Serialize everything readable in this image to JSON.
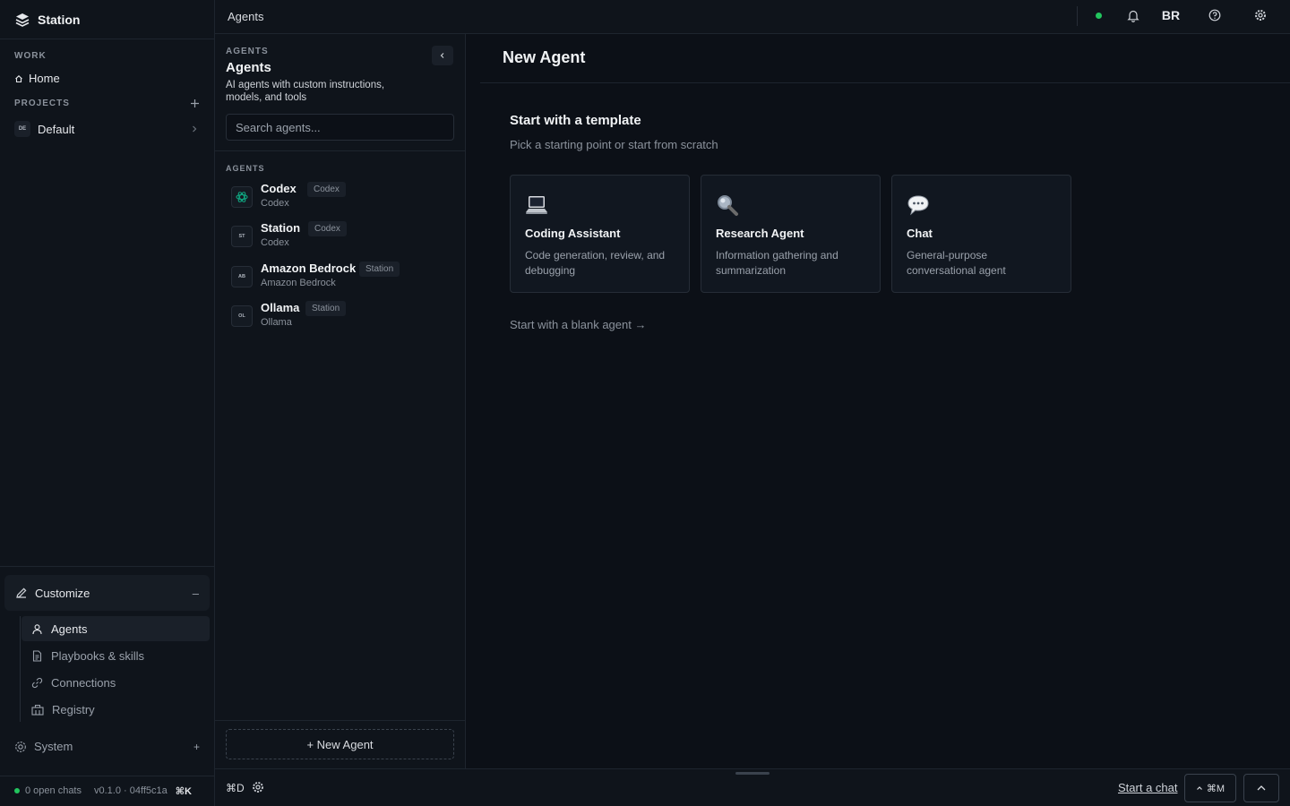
{
  "app": {
    "name": "Station"
  },
  "sidebar": {
    "work_label": "WORK",
    "home_label": "Home",
    "projects_label": "PROJECTS",
    "project": {
      "initials": "DE",
      "name": "Default"
    },
    "customize_label": "Customize",
    "customize_toggle": "–",
    "customize_items": [
      {
        "label": "Agents",
        "icon": "user-icon",
        "active": true
      },
      {
        "label": "Playbooks & skills",
        "icon": "document-icon"
      },
      {
        "label": "Connections",
        "icon": "link-icon"
      },
      {
        "label": "Registry",
        "icon": "building-icon"
      }
    ],
    "system_label": "System",
    "system_toggle": "+",
    "footer": {
      "open_chats": "0 open chats",
      "version": "v0.1.0 · 04ff5c1a",
      "shortcut": "⌘K"
    }
  },
  "topbar": {
    "breadcrumb": "Agents",
    "user_initials": "BR",
    "status_color": "#22c55e"
  },
  "agents_panel": {
    "eyebrow": "AGENTS",
    "title": "Agents",
    "description": "AI agents with custom instructions, models, and tools",
    "search_placeholder": "Search agents...",
    "list_label": "AGENTS",
    "agents": [
      {
        "name": "Codex",
        "tag": "Codex",
        "sub": "Codex",
        "avatar": "openai-icon"
      },
      {
        "name": "Station",
        "tag": "Codex",
        "sub": "Codex",
        "avatar": "ST"
      },
      {
        "name": "Amazon Bedrock",
        "tag": "Station",
        "sub": "Amazon Bedrock",
        "avatar": "AB"
      },
      {
        "name": "Ollama",
        "tag": "Station",
        "sub": "Ollama",
        "avatar": "OL"
      }
    ],
    "new_agent_label": "+ New Agent"
  },
  "main": {
    "title": "New Agent",
    "template_heading": "Start with a template",
    "template_sub": "Pick a starting point or start from scratch",
    "templates": [
      {
        "name": "Coding Assistant",
        "desc": "Code generation, review, and debugging",
        "icon": "laptop-icon"
      },
      {
        "name": "Research Agent",
        "desc": "Information gathering and summarization",
        "icon": "magnifier-icon"
      },
      {
        "name": "Chat",
        "desc": "General-purpose conversational agent",
        "icon": "speech-bubble-icon"
      }
    ],
    "blank_link": "Start with a blank agent →"
  },
  "bottombar": {
    "shortcut_d": "⌘D",
    "start_chat": "Start a chat",
    "shortcut_m": "⌘M"
  }
}
